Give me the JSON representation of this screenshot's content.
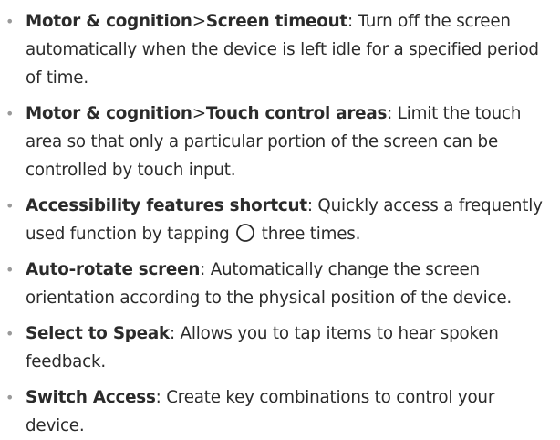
{
  "items": [
    {
      "term_a": "Motor & cognition",
      "separator": ">",
      "term_b": "Screen timeout",
      "desc": ": Turn off the screen automatically when the device is left idle for a specified period of time."
    },
    {
      "term_a": "Motor & cognition",
      "separator": ">",
      "term_b": "Touch control areas",
      "desc": ": Limit the touch area so that only a particular portion of the screen can be controlled by touch input."
    },
    {
      "term": "Accessibility features shortcut",
      "desc_before": ": Quickly access a frequently used function by tapping ",
      "icon": "home-button-circle-icon",
      "desc_after": " three times."
    },
    {
      "term": "Auto-rotate screen",
      "desc": ": Automatically change the screen orientation according to the physical position of the device."
    },
    {
      "term": "Select to Speak",
      "desc": ": Allows you to tap items to hear spoken feedback."
    },
    {
      "term": "Switch Access",
      "desc": ": Create key combinations to control your device."
    }
  ]
}
